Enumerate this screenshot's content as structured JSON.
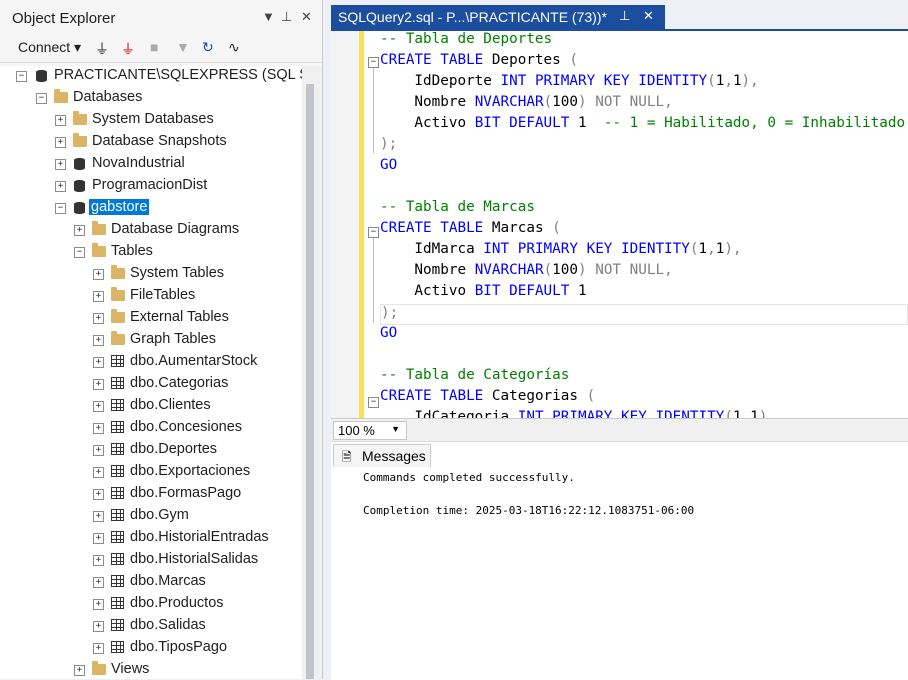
{
  "object_explorer": {
    "title": "Object Explorer",
    "connect_label": "Connect",
    "tree": {
      "server": "PRACTICANTE\\SQLEXPRESS (SQL Ser",
      "databases": "Databases",
      "system_databases": "System Databases",
      "database_snapshots": "Database Snapshots",
      "db1": "NovaIndustrial",
      "db2": "ProgramacionDist",
      "db3": "gabstore",
      "database_diagrams": "Database Diagrams",
      "tables": "Tables",
      "system_tables": "System Tables",
      "file_tables": "FileTables",
      "external_tables": "External Tables",
      "graph_tables": "Graph Tables",
      "table_items": [
        "dbo.AumentarStock",
        "dbo.Categorias",
        "dbo.Clientes",
        "dbo.Concesiones",
        "dbo.Deportes",
        "dbo.Exportaciones",
        "dbo.FormasPago",
        "dbo.Gym",
        "dbo.HistorialEntradas",
        "dbo.HistorialSalidas",
        "dbo.Marcas",
        "dbo.Productos",
        "dbo.Salidas",
        "dbo.TiposPago"
      ],
      "views": "Views"
    }
  },
  "editor": {
    "tab_title": "SQLQuery2.sql - P...\\PRACTICANTE (73))*",
    "zoom": "100 %"
  },
  "messages": {
    "tab_label": "Messages",
    "line1": "Commands completed successfully.",
    "line2": "Completion time: 2025-03-18T16:22:12.1083751-06:00"
  },
  "colors": {
    "accent": "#1b4e9e",
    "selection": "#0078d7",
    "keyword": "#0000ff",
    "comment": "#008000"
  }
}
